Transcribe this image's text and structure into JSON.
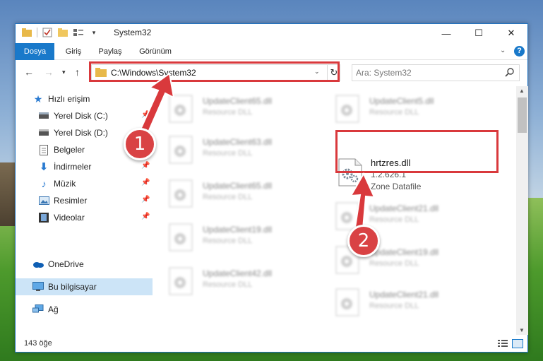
{
  "window": {
    "title": "System32",
    "controls": {
      "minimize": "—",
      "maximize": "☐",
      "close": "✕"
    }
  },
  "ribbon": {
    "tabs": [
      "Dosya",
      "Giriş",
      "Paylaş",
      "Görünüm"
    ],
    "help": "?"
  },
  "address": {
    "path": "C:\\Windows\\System32",
    "search_placeholder": "Ara: System32"
  },
  "sidebar": {
    "items": [
      {
        "label": "Hızlı erişim",
        "icon": "star-icon"
      },
      {
        "label": "Yerel Disk (C:)",
        "icon": "drive-icon",
        "pinned": true
      },
      {
        "label": "Yerel Disk (D:)",
        "icon": "drive-icon",
        "pinned": true
      },
      {
        "label": "Belgeler",
        "icon": "documents-icon",
        "pinned": true
      },
      {
        "label": "İndirmeler",
        "icon": "download-icon",
        "pinned": true
      },
      {
        "label": "Müzik",
        "icon": "music-icon",
        "pinned": true
      },
      {
        "label": "Resimler",
        "icon": "pictures-icon",
        "pinned": true
      },
      {
        "label": "Videolar",
        "icon": "videos-icon",
        "pinned": true
      },
      {
        "label": "OneDrive",
        "icon": "onedrive-icon"
      },
      {
        "label": "Bu bilgisayar",
        "icon": "computer-icon",
        "selected": true
      },
      {
        "label": "Ağ",
        "icon": "network-icon"
      }
    ]
  },
  "files": {
    "left": [
      {
        "name": "UpdateClient65.dll",
        "type": "Resource DLL"
      },
      {
        "name": "UpdateClient63.dll",
        "type": "Resource DLL"
      },
      {
        "name": "UpdateClient65.dll",
        "type": "Resource DLL"
      },
      {
        "name": "UpdateClient19.dll",
        "type": "Resource DLL"
      },
      {
        "name": "UpdateClient42.dll",
        "type": "Resource DLL"
      }
    ],
    "right": [
      {
        "name": "UpdateClient5.dll",
        "type": "Resource DLL"
      },
      {
        "name": "UpdateClient21.dll",
        "type": "Resource DLL"
      },
      {
        "name": "UpdateClient19.dll",
        "type": "Resource DLL"
      },
      {
        "name": "UpdateClient21.dll",
        "type": "Resource DLL"
      }
    ],
    "highlighted": {
      "name": "hrtzres.dll",
      "version": "1.2.626.1",
      "description": "Zone Datafile"
    }
  },
  "status": {
    "count": "143 öğe"
  },
  "annotations": {
    "step1": "1",
    "step2": "2",
    "color": "#d9393c"
  }
}
